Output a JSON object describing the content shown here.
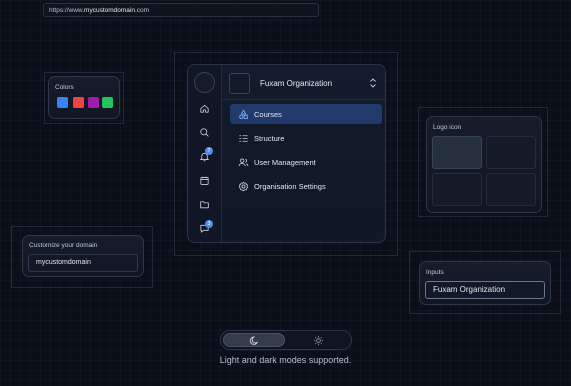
{
  "browser": {
    "url_prefix": "https://www.",
    "url_host": "mycustomdomain",
    "url_suffix": ".com"
  },
  "colors_card": {
    "title": "Colors",
    "swatches": [
      "#3b82f6",
      "#ef4444",
      "#a21caf",
      "#22c55e"
    ]
  },
  "app": {
    "org_name": "Fuxam Organization",
    "rail": {
      "icons": [
        "home-icon",
        "search-icon",
        "bell-icon",
        "calendar-icon",
        "folder-icon",
        "chat-icon"
      ],
      "notification_badge": "7",
      "message_badge": "3"
    },
    "nav": [
      {
        "label": "Courses",
        "icon": "shapes-icon",
        "active": true
      },
      {
        "label": "Structure",
        "icon": "list-icon",
        "active": false
      },
      {
        "label": "User Management",
        "icon": "users-icon",
        "active": false
      },
      {
        "label": "Organisation Settings",
        "icon": "gear-icon",
        "active": false
      }
    ]
  },
  "logo_card": {
    "title": "Logo icon"
  },
  "domain_card": {
    "title": "Customize your domain",
    "value": "mycustomdomain"
  },
  "inputs_card": {
    "title": "Inputs",
    "value": "Fuxam Organization"
  },
  "theme_toggle": {
    "options": [
      "moon-icon",
      "sun-icon"
    ],
    "selected": "dark"
  },
  "caption": "Light and dark modes supported.",
  "accent": "#1f3a6b"
}
